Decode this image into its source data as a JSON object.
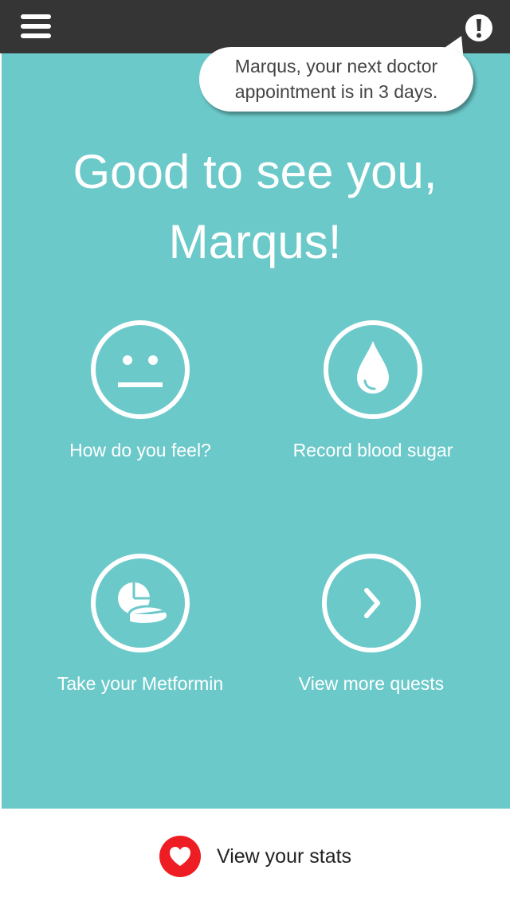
{
  "header": {
    "menu_icon": "hamburger-menu-icon",
    "alert_icon": "exclamation-icon",
    "alert_message": [
      "Marqus, your next doctor",
      "appointment is in 3 days."
    ]
  },
  "greeting": {
    "line1": "Good to see you,",
    "line2": "Marqus!"
  },
  "quests": [
    {
      "label": "How do you feel?",
      "icon": "neutral-face-icon"
    },
    {
      "label": "Record blood sugar",
      "icon": "blood-drop-icon"
    },
    {
      "label": "Take your Metformin",
      "icon": "pills-icon"
    },
    {
      "label": "View more quests",
      "icon": "chevron-right-icon"
    }
  ],
  "footer": {
    "stats_label": "View your stats",
    "stats_icon": "heart-icon"
  },
  "colors": {
    "header_bg": "#353535",
    "main_bg": "#6cc9ca",
    "heart_red": "#ee1d23"
  }
}
